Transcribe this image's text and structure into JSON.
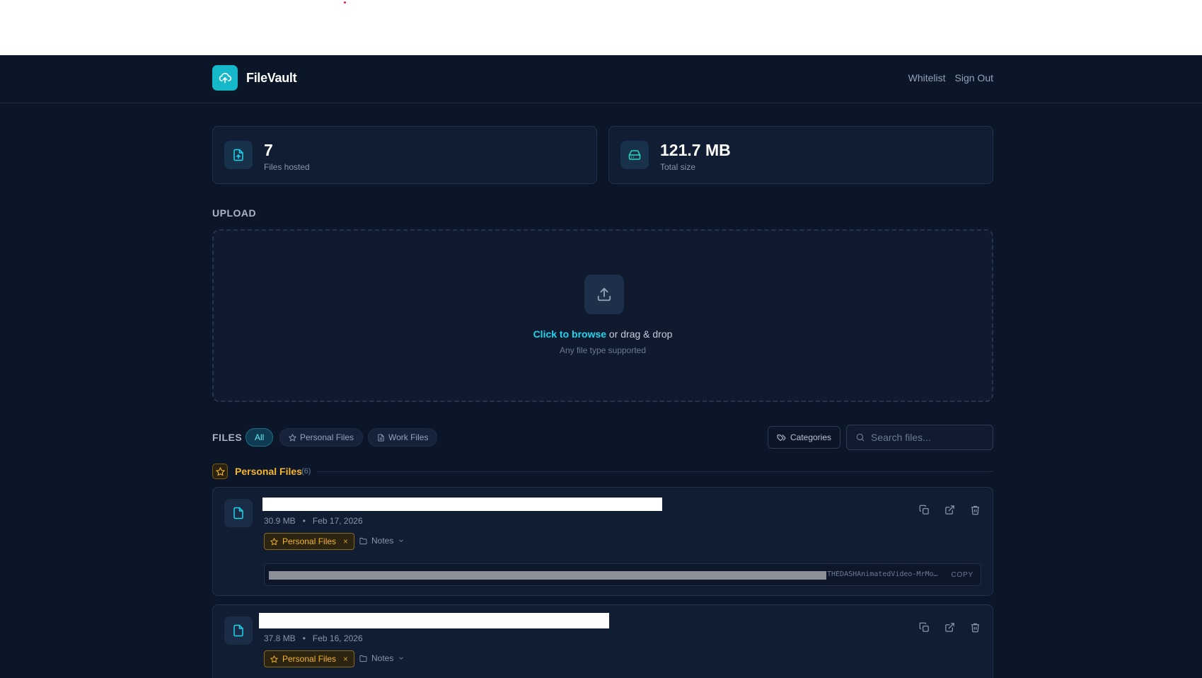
{
  "app": {
    "name": "FileVault"
  },
  "nav": {
    "links": [
      "Whitelist",
      "Sign Out"
    ]
  },
  "stats": [
    {
      "value": "7",
      "label": "Files hosted",
      "icon": "file-upload-icon"
    },
    {
      "value": "121.7 MB",
      "label": "Total size",
      "icon": "hard-drive-icon"
    }
  ],
  "upload": {
    "title": "UPLOAD",
    "browse": "Click to browse",
    "rest": " or drag & drop",
    "sub": "Any file type supported"
  },
  "files": {
    "title": "FILES",
    "filters": [
      "All",
      "Personal Files",
      "Work Files"
    ],
    "active_filter": "All",
    "categories_label": "Categories",
    "search_placeholder": "Search files..."
  },
  "group": {
    "name": "Personal Files",
    "count": "(6)"
  },
  "file_items": [
    {
      "size": "30.9 MB",
      "dot": "•",
      "date": "Feb 17, 2026",
      "tag": "Personal Files",
      "tag_remove": "×",
      "notes": "Notes",
      "url_tail": "THEDASHAnimatedVideo-MrMo…",
      "copy": "COPY"
    },
    {
      "size": "37.8 MB",
      "dot": "•",
      "date": "Feb 16, 2026",
      "tag": "Personal Files",
      "tag_remove": "×",
      "notes": "Notes"
    }
  ],
  "colors": {
    "accent": "#14b8c8",
    "background": "#0b1628",
    "card": "#111d33",
    "category": "#f5b42a"
  }
}
